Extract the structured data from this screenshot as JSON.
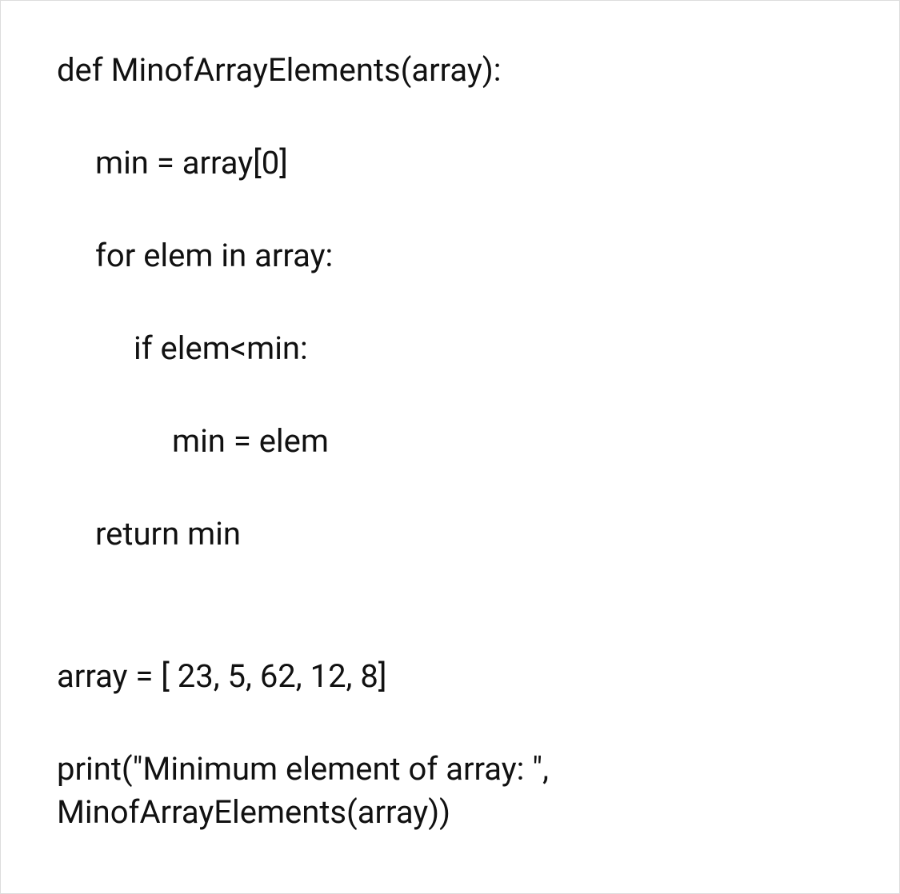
{
  "code": {
    "l1": "def MinofArrayElements(array):",
    "l2": "min = array[0]",
    "l3": "for elem in array:",
    "l4": "if elem<min:",
    "l5": "min = elem",
    "l6": "return min",
    "l7": "array = [ 23, 5, 62, 12, 8]",
    "l8": "print(\"Minimum element of array: \", MinofArrayElements(array))"
  }
}
